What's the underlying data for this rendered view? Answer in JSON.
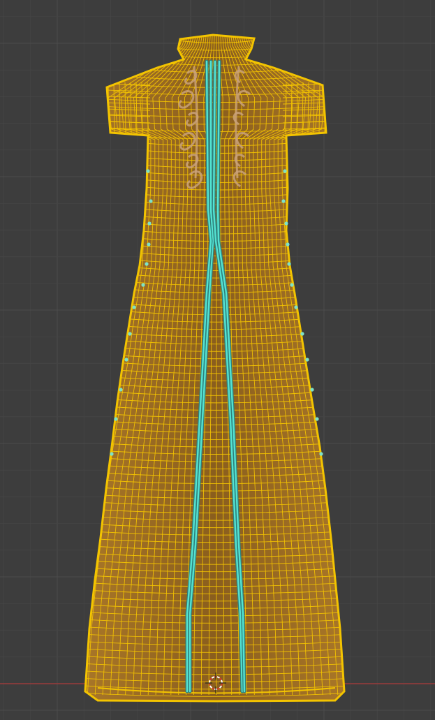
{
  "viewport": {
    "background_color": "#3d3d3d",
    "grid": {
      "enabled": true,
      "major_color": "#4b4b4b",
      "minor_color": "#444444"
    },
    "horizon_axis": {
      "visible": true,
      "color": "#ab3a3a"
    },
    "object": {
      "name": "dress-mesh",
      "mode": "edit",
      "fill_color": "#9a6a24",
      "wire_color": "#f3c400",
      "selected_edge_color": "#54e3d2",
      "selected_vertex_color": "#7de2c8",
      "embroidery_color": "#c9a17a"
    },
    "cursor_3d": {
      "icon": "3d-cursor-icon",
      "ring_color_a": "#d13a2a",
      "ring_color_b": "#ffffff"
    }
  }
}
